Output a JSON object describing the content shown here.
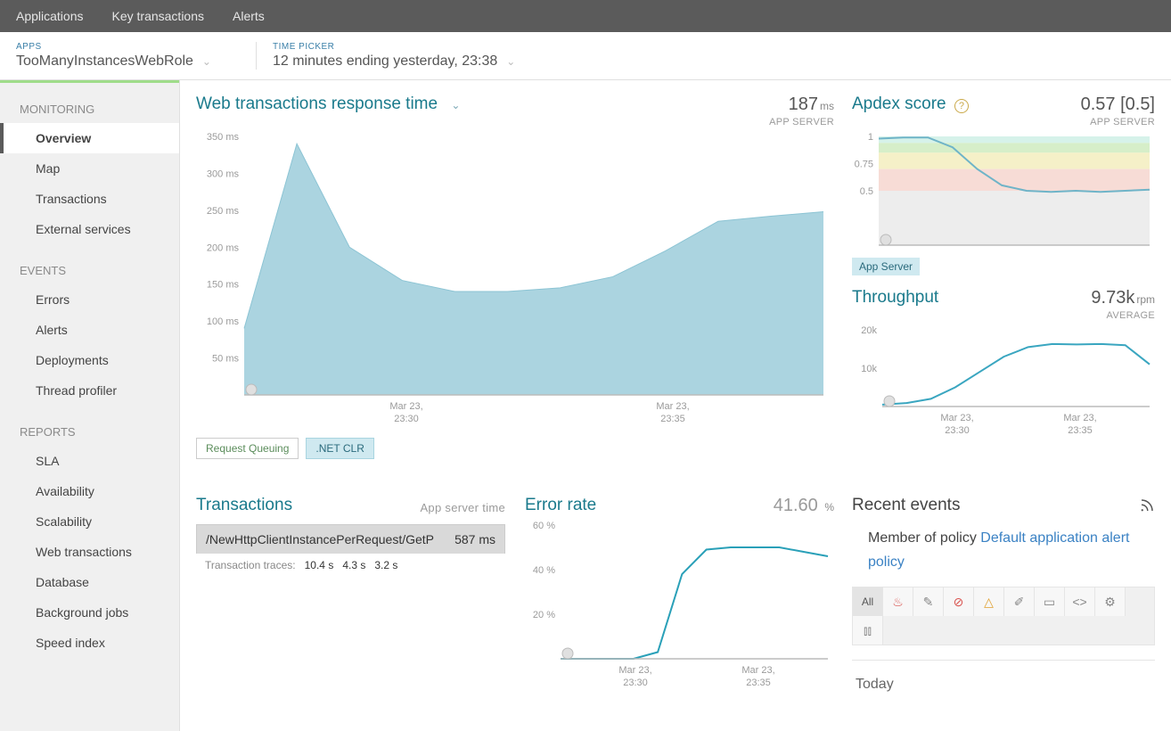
{
  "topnav": {
    "tabs": [
      "Applications",
      "Key transactions",
      "Alerts"
    ]
  },
  "apps_picker": {
    "kicker": "APPS",
    "value": "TooManyInstancesWebRole"
  },
  "time_picker": {
    "kicker": "TIME PICKER",
    "value": "12 minutes ending yesterday, 23:38"
  },
  "sidebar": {
    "sections": [
      {
        "title": "MONITORING",
        "items": [
          "Overview",
          "Map",
          "Transactions",
          "External services"
        ],
        "active": "Overview"
      },
      {
        "title": "EVENTS",
        "items": [
          "Errors",
          "Alerts",
          "Deployments",
          "Thread profiler"
        ]
      },
      {
        "title": "REPORTS",
        "items": [
          "SLA",
          "Availability",
          "Scalability",
          "Web transactions",
          "Database",
          "Background jobs",
          "Speed index"
        ]
      }
    ]
  },
  "main_chart": {
    "title": "Web transactions response time",
    "value": "187",
    "unit": "ms",
    "sub": "APP SERVER",
    "pills": [
      "Request Queuing",
      ".NET CLR"
    ],
    "pill_active": 1
  },
  "tx_table": {
    "title": "Transactions",
    "right": "App server time",
    "rows": [
      {
        "name": "/NewHttpClientInstancePerRequest/GetP",
        "time": "587 ms"
      }
    ],
    "traces_label": "Transaction traces:",
    "traces": [
      "10.4 s",
      "4.3 s",
      "3.2 s"
    ]
  },
  "error_panel": {
    "title": "Error rate",
    "value": "41.60",
    "unit": "%"
  },
  "apdex": {
    "title": "Apdex score",
    "value": "0.57 [0.5]",
    "sub": "APP SERVER",
    "legend": "App Server"
  },
  "throughput": {
    "title": "Throughput",
    "value": "9.73k",
    "unit": "rpm",
    "sub": "AVERAGE"
  },
  "events": {
    "title": "Recent events",
    "policy_prefix": "Member of policy ",
    "policy_link": "Default application alert policy",
    "filter_all": "All",
    "today": "Today"
  },
  "chart_data": [
    {
      "id": "response_time",
      "type": "area",
      "title": "Web transactions response time",
      "ylabel": "ms",
      "ylim": [
        0,
        350
      ],
      "y_ticks": [
        50,
        100,
        150,
        200,
        250,
        300,
        350
      ],
      "x_ticks": [
        "Mar 23, 23:30",
        "Mar 23, 23:35"
      ],
      "categories": [
        "23:27",
        "23:28",
        "23:29",
        "23:30",
        "23:31",
        "23:32",
        "23:33",
        "23:34",
        "23:35",
        "23:36",
        "23:37",
        "23:38"
      ],
      "values": [
        90,
        340,
        200,
        155,
        140,
        140,
        145,
        160,
        195,
        235,
        242,
        248
      ]
    },
    {
      "id": "apdex",
      "type": "line",
      "title": "Apdex score",
      "ylim": [
        0,
        1
      ],
      "y_ticks": [
        0.5,
        0.75,
        1
      ],
      "x_ticks": [
        "Mar 23, 23:30",
        "Mar 23, 23:35"
      ],
      "categories": [
        "23:27",
        "23:28",
        "23:29",
        "23:30",
        "23:31",
        "23:32",
        "23:33",
        "23:34",
        "23:35",
        "23:36",
        "23:37",
        "23:38"
      ],
      "values": [
        0.98,
        0.99,
        0.99,
        0.9,
        0.7,
        0.55,
        0.5,
        0.49,
        0.5,
        0.49,
        0.5,
        0.51
      ]
    },
    {
      "id": "throughput",
      "type": "line",
      "title": "Throughput",
      "ylabel": "rpm",
      "ylim": [
        0,
        20000
      ],
      "y_ticks": [
        10000,
        20000
      ],
      "y_tick_labels": [
        "10k",
        "20k"
      ],
      "x_ticks": [
        "Mar 23, 23:30",
        "Mar 23, 23:35"
      ],
      "categories": [
        "23:27",
        "23:28",
        "23:29",
        "23:30",
        "23:31",
        "23:32",
        "23:33",
        "23:34",
        "23:35",
        "23:36",
        "23:37",
        "23:38"
      ],
      "values": [
        500,
        900,
        2000,
        5000,
        9000,
        13000,
        15500,
        16300,
        16200,
        16300,
        16000,
        11000
      ]
    },
    {
      "id": "error_rate",
      "type": "line",
      "title": "Error rate",
      "ylabel": "%",
      "ylim": [
        0,
        60
      ],
      "y_ticks": [
        20,
        40,
        60
      ],
      "x_ticks": [
        "Mar 23, 23:30",
        "Mar 23, 23:35"
      ],
      "categories": [
        "23:27",
        "23:28",
        "23:29",
        "23:30",
        "23:31",
        "23:32",
        "23:33",
        "23:34",
        "23:35",
        "23:36",
        "23:37",
        "23:38"
      ],
      "values": [
        0,
        0,
        0,
        0,
        3,
        38,
        49,
        50,
        50,
        50,
        48,
        46
      ]
    }
  ]
}
